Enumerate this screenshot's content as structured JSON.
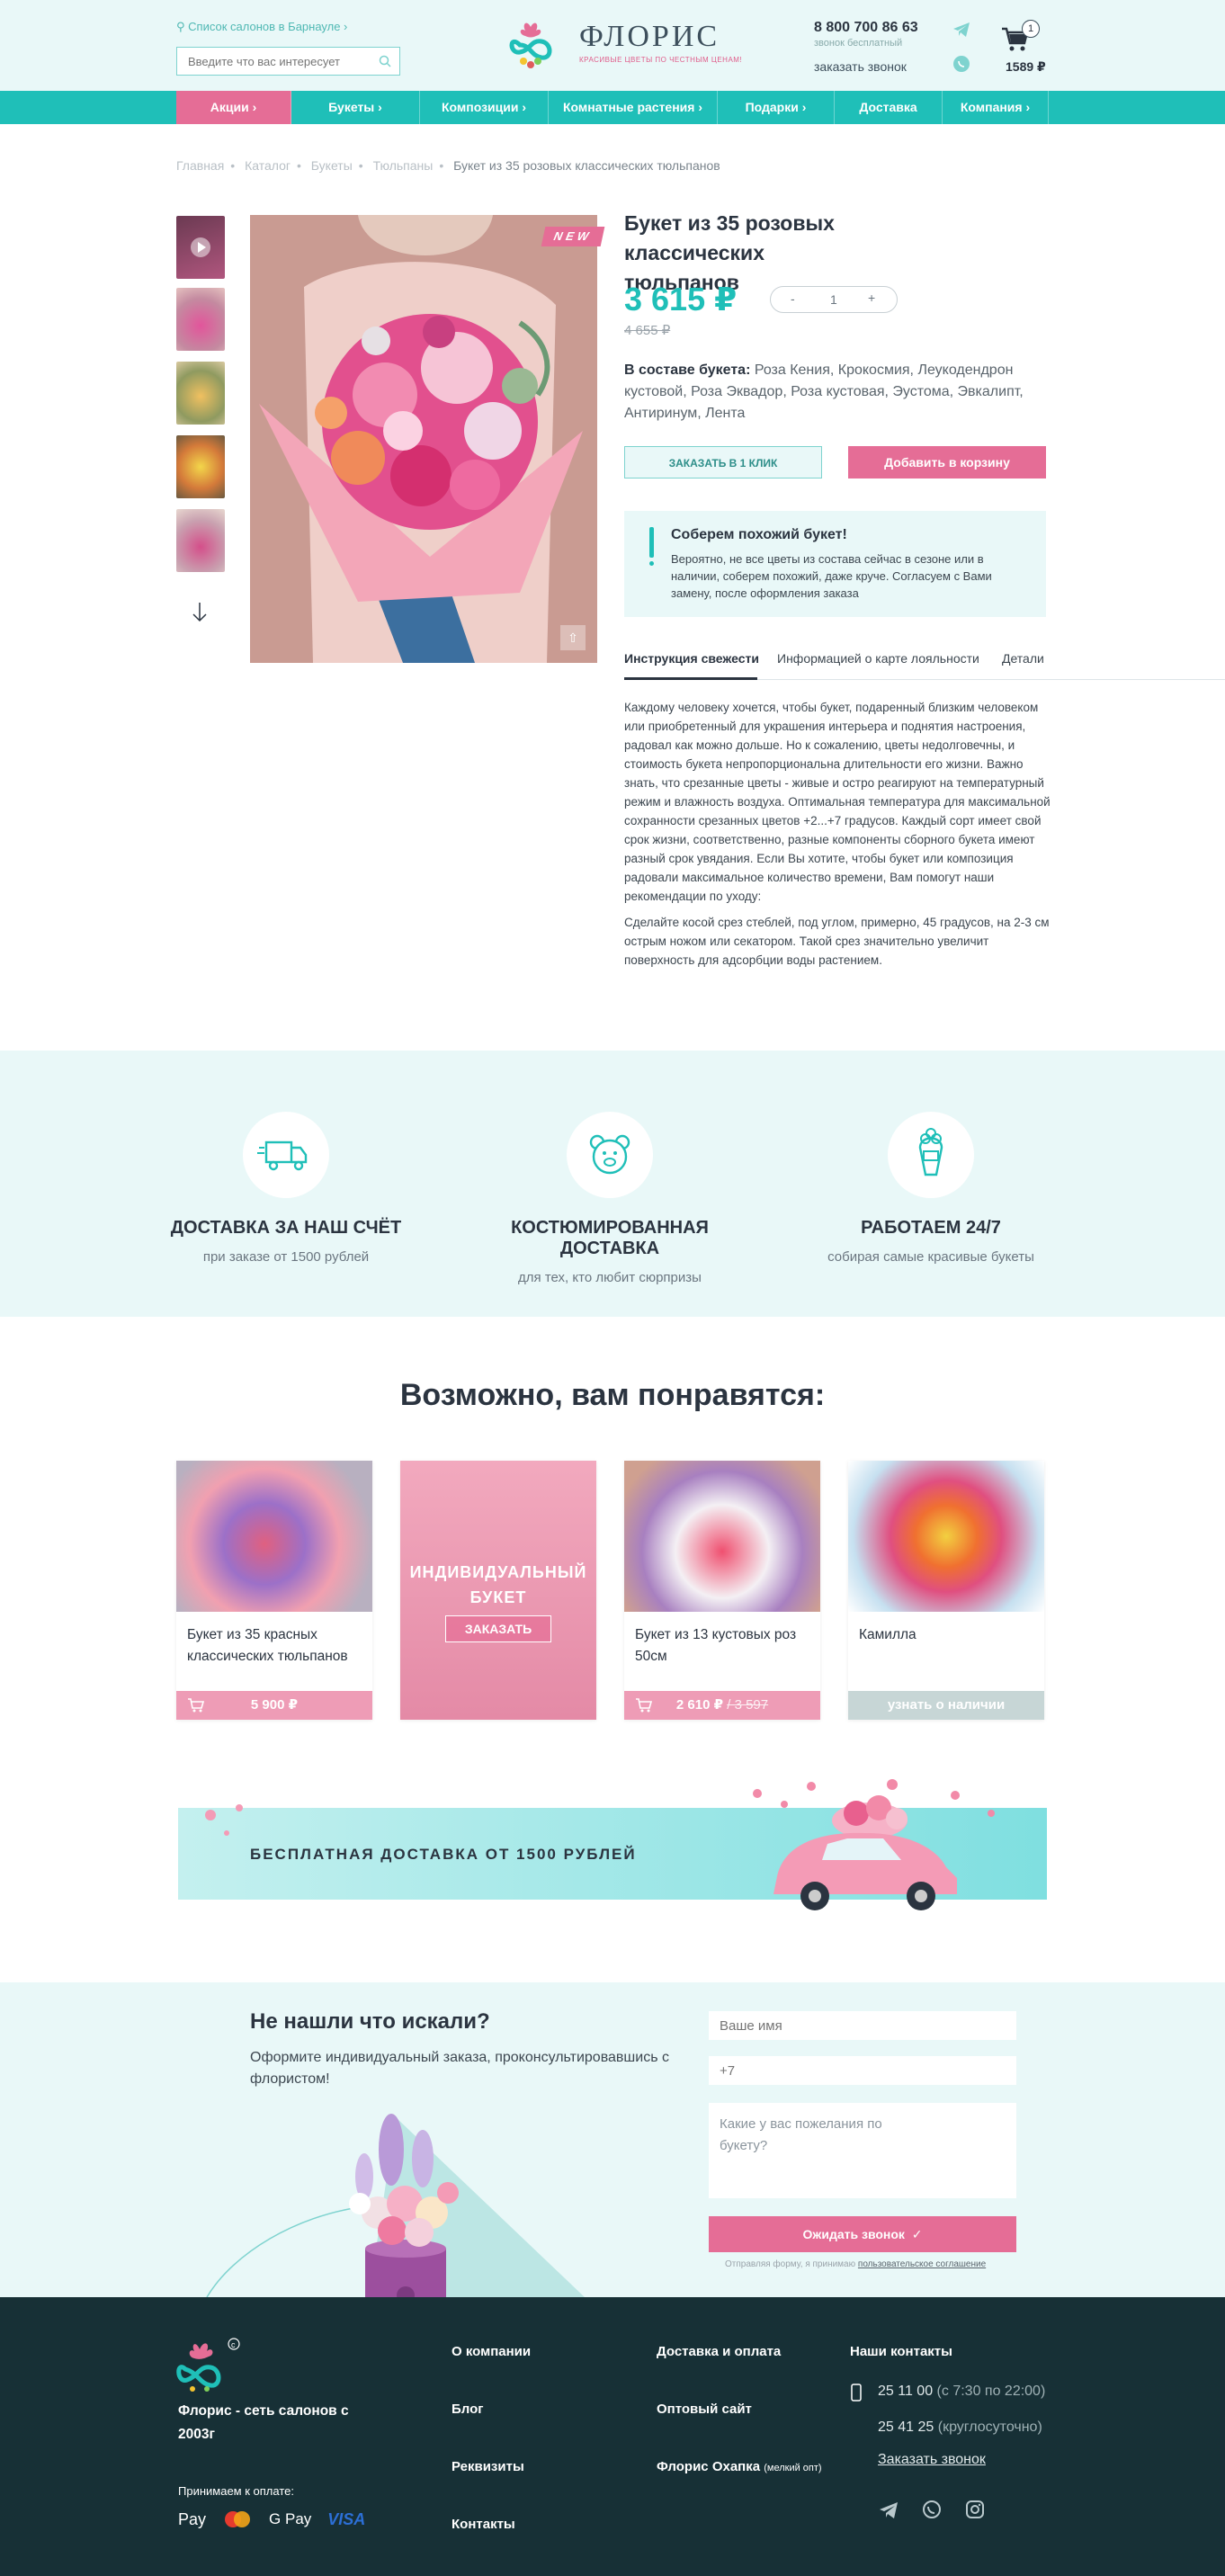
{
  "header": {
    "city_link": "Список салонов в Барнауле ›",
    "search_placeholder": "Введите что вас интересует",
    "logo_title": "ФЛОРИС",
    "logo_subtitle": "КРАСИВЫЕ ЦВЕТЫ ПО ЧЕСТНЫМ ЦЕНАМ!",
    "phone": "8 800 700 86 63",
    "phone_note": "звонок бесплатный",
    "callback": "заказать звонок",
    "cart_count": "1",
    "cart_sum": "1589 ₽"
  },
  "nav": {
    "items": [
      {
        "label": "Акции ›",
        "width": 128
      },
      {
        "label": "Букеты ›",
        "width": 143
      },
      {
        "label": "Композиции ›",
        "width": 143
      },
      {
        "label": "Комнатные растения ›",
        "width": 188
      },
      {
        "label": "Подарки ›",
        "width": 130
      },
      {
        "label": "Доставка",
        "width": 120
      },
      {
        "label": "Компания ›",
        "width": 118
      }
    ]
  },
  "breadcrumb": [
    "Главная",
    "Каталог",
    "Букеты",
    "Тюльпаны",
    "Букет из 35 розовых классических тюльпанов"
  ],
  "product": {
    "badge": "NEW",
    "title": "Букет из 35 розовых классических тюльпанов",
    "price": "3 615 ₽",
    "old_price": "4 655 ₽",
    "qty_minus": "-",
    "qty_value": "1",
    "qty_plus": "+",
    "composition_label": "В составе букета:",
    "composition": "Роза Кения, Крокосмия, Леукодендрон кустовой, Роза Эквадор, Роза кустовая, Эустома, Эвкалипт, Антиринум, Лента",
    "btn_one_click": "ЗАКАЗАТЬ В 1 КЛИК",
    "btn_cart": "Добавить в корзину",
    "info_title": "Соберем похожий букет!",
    "info_text": "Вероятно, не все цветы из состава сейчас в сезоне или в наличии, соберем похожий, даже круче. Согласуем с Вами замену, после оформления заказа",
    "tabs": [
      "Инструкция свежести",
      "Информацией о карте лояльности",
      "Детали"
    ],
    "desc_1": "Каждому человеку хочется, чтобы букет, подаренный близким человеком или приобретенный для украшения интерьера и поднятия настроения, радовал как можно дольше. Но к сожалению, цветы недолговечны, и стоимость букета непропорциональна длительности его жизни. Важно знать, что срезанные цветы - живые и остро реагируют на температурный режим и влажность воздуха. Оптимальная температура для максимальной сохранности срезанных цветов +2...+7 градусов. Каждый сорт имеет свой срок жизни, соответственно, разные компоненты сборного букета имеют разный срок увядания. Если Вы хотите, чтобы букет или композиция радовали максимальное количество времени, Вам помогут наши рекомендации по уходу:",
    "desc_2": "Сделайте косой срез стеблей, под углом, примерно, 45 градусов, на 2-3 см острым ножом или секатором. Такой срез значительно увеличит поверхность для адсорбции воды растением."
  },
  "features": [
    {
      "title": "ДОСТАВКА ЗА НАШ СЧЁТ",
      "text": "при заказе от 1500 рублей",
      "icon": "truck-icon"
    },
    {
      "title": "КОСТЮМИРОВАННАЯ ДОСТАВКА",
      "text": "для тех, кто любит сюрпризы",
      "icon": "bear-icon"
    },
    {
      "title": "РАБОТАЕМ 24/7",
      "text": "собирая самые красивые букеты",
      "icon": "bouquet-icon"
    }
  ],
  "recommend": {
    "title": "Возможно, вам понравятся:",
    "cards": [
      {
        "name": "Букет из 35 красных классических тюльпанов",
        "price": "5 900 ₽"
      },
      {
        "promo": "ИНДИВИДУАЛЬНЫЙ БУКЕТ",
        "button": "ЗАКАЗАТЬ"
      },
      {
        "name": "Букет из 13 кустовых роз 50см",
        "price": "2 610 ₽",
        "old": "3 597"
      },
      {
        "name": "Камилла",
        "status": "узнать о наличии"
      }
    ]
  },
  "banner": {
    "text": "БЕСПЛАТНАЯ ДОСТАВКА ОТ 1500 РУБЛЕЙ"
  },
  "form": {
    "title": "Не нашли что искали?",
    "text": "Оформите индивидуальный заказа, проконсультировавшись с флористом!",
    "name_placeholder": "Ваше имя",
    "phone_placeholder": "+7",
    "wish_placeholder": "Какие у вас пожелания по букету?",
    "submit": "Ожидать звонок",
    "note": "Отправляя форму, я принимаю",
    "note_link": "пользовательское соглашение"
  },
  "footer": {
    "about": "Флорис - сеть салонов с 2003г",
    "pay_label": "Принимаем к оплате:",
    "pay_methods": [
      "Pay",
      "G Pay",
      "VISA"
    ],
    "col1": [
      "О компании",
      "Блог",
      "Реквизиты",
      "Контакты"
    ],
    "col2": [
      "Доставка и оплата",
      "Оптовый сайт",
      "Флорис Охапка"
    ],
    "col2_small": "(мелкий опт)",
    "contacts_title": "Наши контакты",
    "phone1": "25 11 00",
    "phone1_note": "(с 7:30 по 22:00)",
    "phone2": "25 41 25",
    "phone2_note": "(круглосуточно)",
    "callback": "Заказать звонок"
  },
  "colors": {
    "accent": "#1fbfb8",
    "pink": "#e56d96",
    "dark": "#173036",
    "light": "#e9f8f8"
  }
}
